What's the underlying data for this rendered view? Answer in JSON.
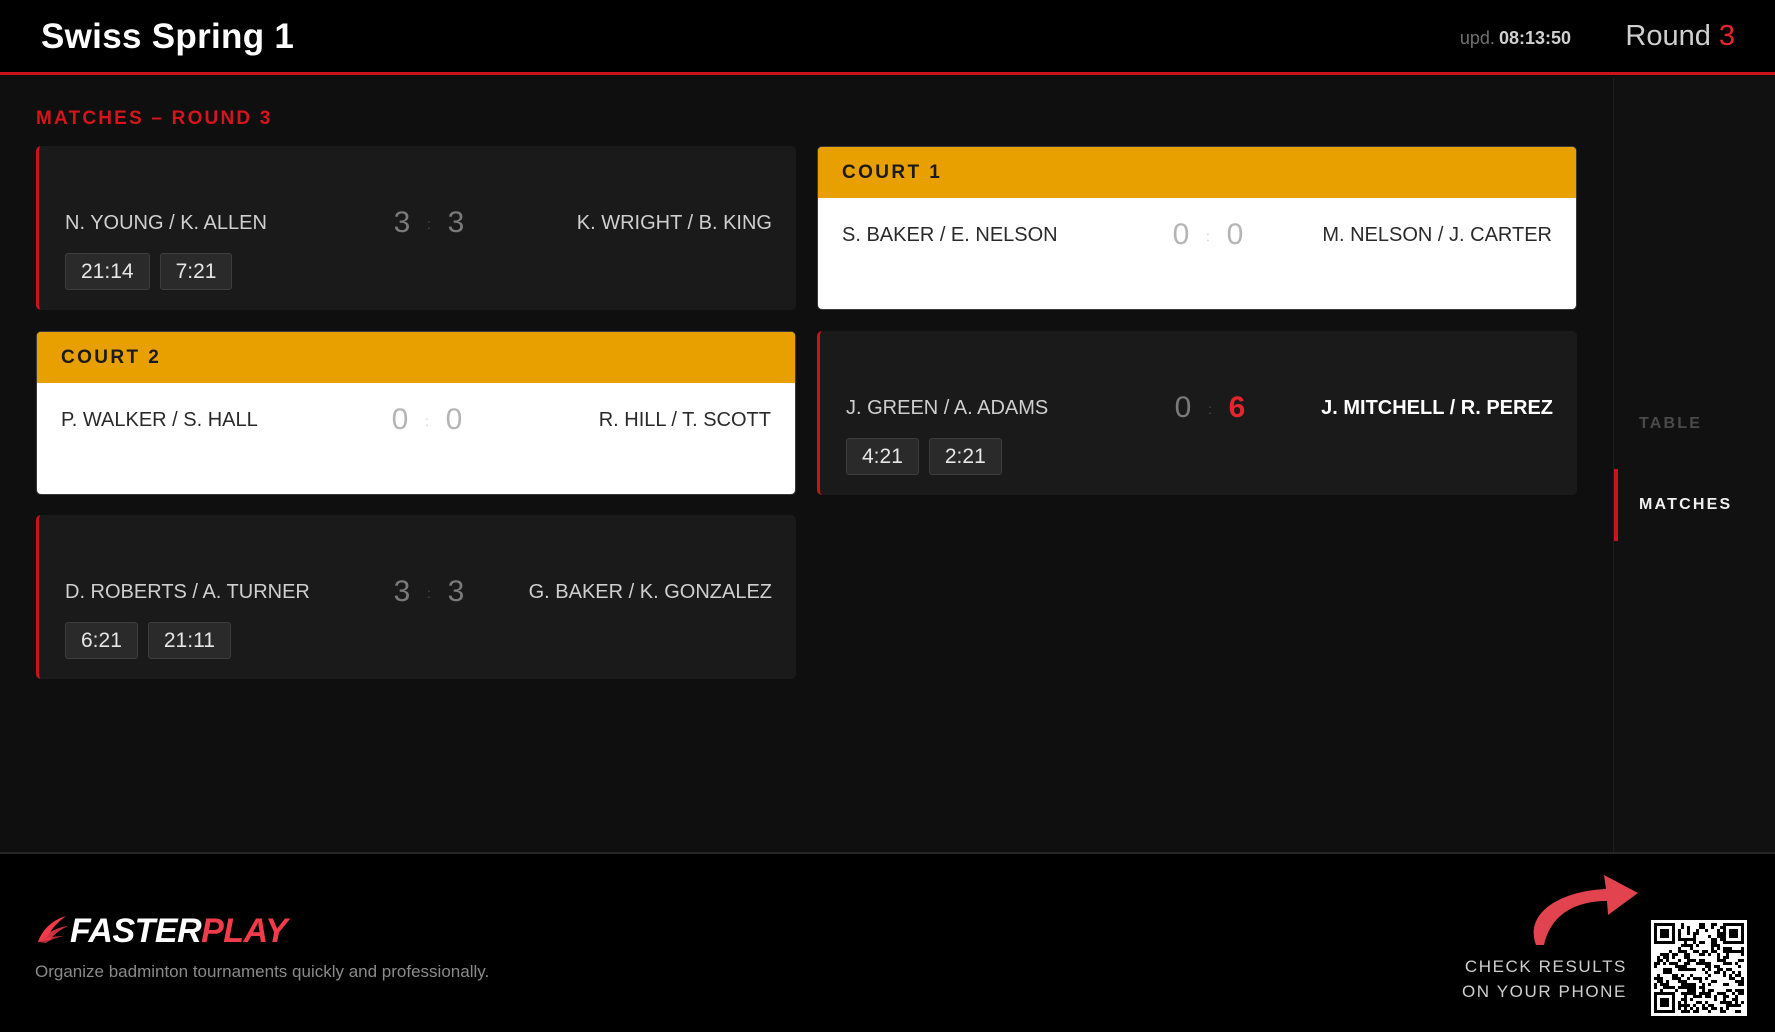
{
  "header": {
    "title": "Swiss Spring 1",
    "upd_label": "upd.",
    "upd_time": "08:13:50",
    "round_label": "Round",
    "round_number": "3"
  },
  "section_title": "MATCHES – ROUND 3",
  "matches": [
    {
      "status": "finished",
      "team_left": "N. Young / K. Allen",
      "team_right": "K. Wright / B. King",
      "score_left": "3",
      "score_right": "3",
      "sets": [
        "21:14",
        "7:21"
      ]
    },
    {
      "status": "live",
      "court": "COURT 1",
      "team_left": "S. Baker / E. Nelson",
      "team_right": "M. Nelson / J. Carter",
      "score_left": "0",
      "score_right": "0"
    },
    {
      "status": "live",
      "court": "COURT 2",
      "team_left": "P. Walker / S. Hall",
      "team_right": "R. Hill / T. Scott",
      "score_left": "0",
      "score_right": "0"
    },
    {
      "status": "finished",
      "team_left": "J. Green / A. Adams",
      "team_right": "J. Mitchell / R. Perez",
      "score_left": "0",
      "score_right": "6",
      "winner": "right",
      "sets": [
        "4:21",
        "2:21"
      ]
    },
    {
      "status": "finished",
      "team_left": "D. Roberts / A. Turner",
      "team_right": "G. Baker / K. Gonzalez",
      "score_left": "3",
      "score_right": "3",
      "sets": [
        "6:21",
        "21:11"
      ]
    }
  ],
  "nav": {
    "table": "TABLE",
    "matches": "MATCHES"
  },
  "footer": {
    "logo_fast": "FASTER",
    "logo_play": "PLAY",
    "tagline": "Organize badminton tournaments quickly and professionally.",
    "check_line1": "CHECK RESULTS",
    "check_line2": "ON YOUR PHONE"
  },
  "colors": {
    "accent_red": "#c8141b",
    "court_yellow": "#e8a000",
    "logo_red": "#ef3b4a"
  }
}
